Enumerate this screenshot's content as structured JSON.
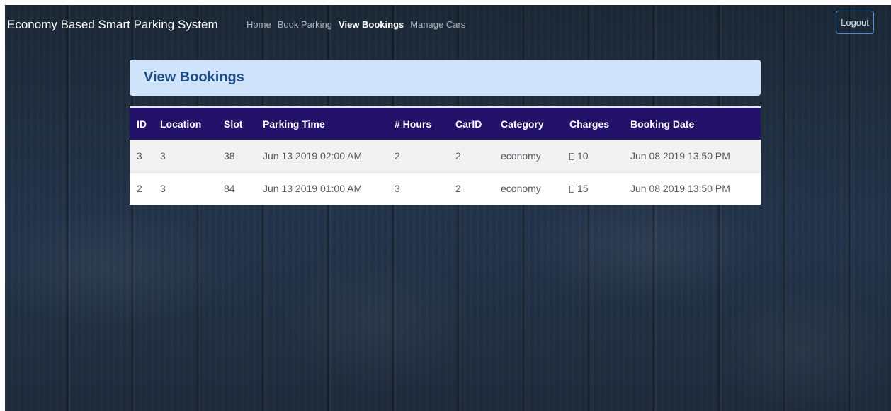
{
  "navbar": {
    "brand": "Economy Based Smart Parking System",
    "links": [
      {
        "label": "Home",
        "active": false
      },
      {
        "label": "Book Parking",
        "active": false
      },
      {
        "label": "View Bookings",
        "active": true
      },
      {
        "label": "Manage Cars",
        "active": false
      }
    ],
    "logout_label": "Logout"
  },
  "page": {
    "title": "View Bookings"
  },
  "table": {
    "columns": [
      "ID",
      "Location",
      "Slot",
      "Parking Time",
      "# Hours",
      "CarID",
      "Category",
      "Charges",
      "Booking Date"
    ],
    "rows": [
      [
        "3",
        "3",
        "38",
        "Jun 13 2019 02:00 AM",
        "2",
        "2",
        "economy",
        "10",
        "Jun 08 2019 13:50 PM"
      ],
      [
        "2",
        "3",
        "84",
        "Jun 13 2019 01:00 AM",
        "3",
        "2",
        "economy",
        "15",
        "Jun 08 2019 13:50 PM"
      ]
    ],
    "currency_icon": "currency-symbol-icon"
  },
  "colors": {
    "background": "#1f2a37",
    "navbar_text": "#ffffff",
    "nav_link_inactive": "#aab2bc",
    "logout_border": "#4f8fd6",
    "header_card_bg": "#cfe3fb",
    "header_title": "#1f4e86",
    "table_header_bg": "#22126a",
    "row_striped_bg": "#f2f2f2",
    "cell_text": "#555b63"
  }
}
